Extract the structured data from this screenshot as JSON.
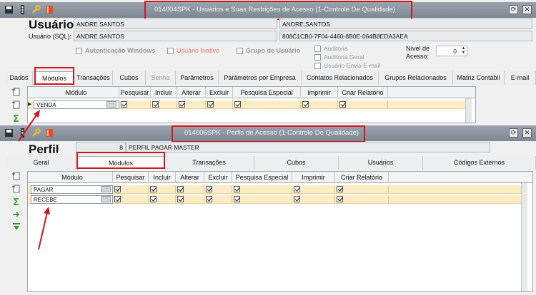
{
  "win1": {
    "title": "014004SPK - Usuários e Suas Restrições de Acesso (1-Controle De Qualidade)",
    "heading": "Usuário",
    "sql_label": "Usuário (SQL):",
    "login_value": "ANDRE.SANTOS",
    "login_value2": "ANDRE.SANTOS",
    "sql_value": "ANDRE.SANTOS",
    "guid_value": "808C1CB0-7F04-4460-8B0E-064B8EDA3AEA",
    "chk_windows": "Autenticação Windows",
    "chk_inactive": "Usuário Inativo",
    "chk_group": "Grupo de Usuário",
    "chk_audit": "Auditoria",
    "chk_audit_general": "Auditoria Geral",
    "chk_audit_email": "Usuário Envia E-mail",
    "level_label": "Nível de Acesso:",
    "level_value": "0",
    "tabs": [
      "Dados",
      "Módulos",
      "Transações",
      "Cubos",
      "Senha",
      "Parâmetros",
      "Parâmetros por Empresa",
      "Contatos Relacionados",
      "Grupos Relacionados",
      "Matriz Contábil",
      "E-mail"
    ],
    "grid_headers": [
      "Módulo",
      "Pesquisar",
      "Incluir",
      "Alterar",
      "Excluir",
      "Pesquisa Especial",
      "Imprimir",
      "Criar Relatório"
    ],
    "rows": [
      "VENDA"
    ]
  },
  "win2": {
    "title": "014006SPK - Perfis de Acesso (1-Controle De Qualidade)",
    "heading": "Perfil",
    "profile_id": "8",
    "profile_name": "PERFIL PAGAR MASTER",
    "tabs": [
      "Geral",
      "Módulos",
      "Transações",
      "Cubos",
      "Usuários",
      "Códigos Externos"
    ],
    "grid_headers": [
      "Módulo",
      "Pesquisar",
      "Incluir",
      "Alterar",
      "Excluir",
      "Pesquisa Especial",
      "Imprimir",
      "Criar Relatório"
    ],
    "rows": [
      "PAGAR",
      "RECEBE"
    ]
  },
  "colors": {
    "highlight": "#d8141b",
    "row": "#fbecc4",
    "titlebar": "#8a939d"
  }
}
